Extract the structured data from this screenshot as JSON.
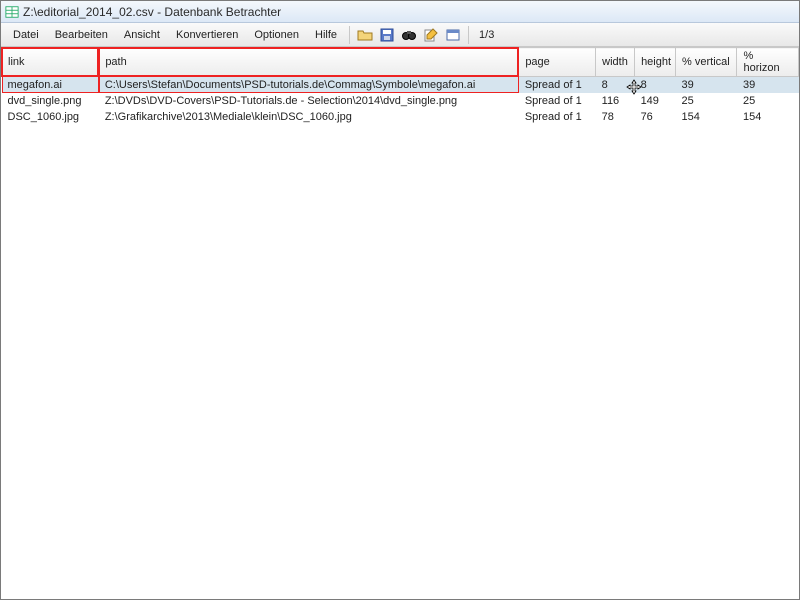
{
  "window": {
    "title": "Z:\\editorial_2014_02.csv - Datenbank Betrachter"
  },
  "menu": {
    "items": [
      "Datei",
      "Bearbeiten",
      "Ansicht",
      "Konvertieren",
      "Optionen",
      "Hilfe"
    ],
    "counter": "1/3"
  },
  "table": {
    "columns": [
      "link",
      "path",
      "page",
      "width",
      "height",
      "% vertical",
      "% horizon"
    ],
    "selected_index": 0,
    "rows": [
      {
        "link": "megafon.ai",
        "path": "C:\\Users\\Stefan\\Documents\\PSD-tutorials.de\\Commag\\Symbole\\megafon.ai",
        "page": "Spread of 1",
        "width": "8",
        "height": "8",
        "vertical": "39",
        "horizontal": "39"
      },
      {
        "link": "dvd_single.png",
        "path": "Z:\\DVDs\\DVD-Covers\\PSD-Tutorials.de - Selection\\2014\\dvd_single.png",
        "page": "Spread of 1",
        "width": "116",
        "height": "149",
        "vertical": "25",
        "horizontal": "25"
      },
      {
        "link": "DSC_1060.jpg",
        "path": "Z:\\Grafikarchive\\2013\\Mediale\\klein\\DSC_1060.jpg",
        "page": "Spread of 1",
        "width": "78",
        "height": "76",
        "vertical": "154",
        "horizontal": "154"
      }
    ]
  },
  "icons": {
    "app": "spreadsheet-icon",
    "toolbar": [
      "folder-open-icon",
      "save-icon",
      "binoculars-icon",
      "edit-icon",
      "window-icon"
    ]
  },
  "colors": {
    "highlight": "#e22222",
    "selection": "#d6e4ee"
  }
}
